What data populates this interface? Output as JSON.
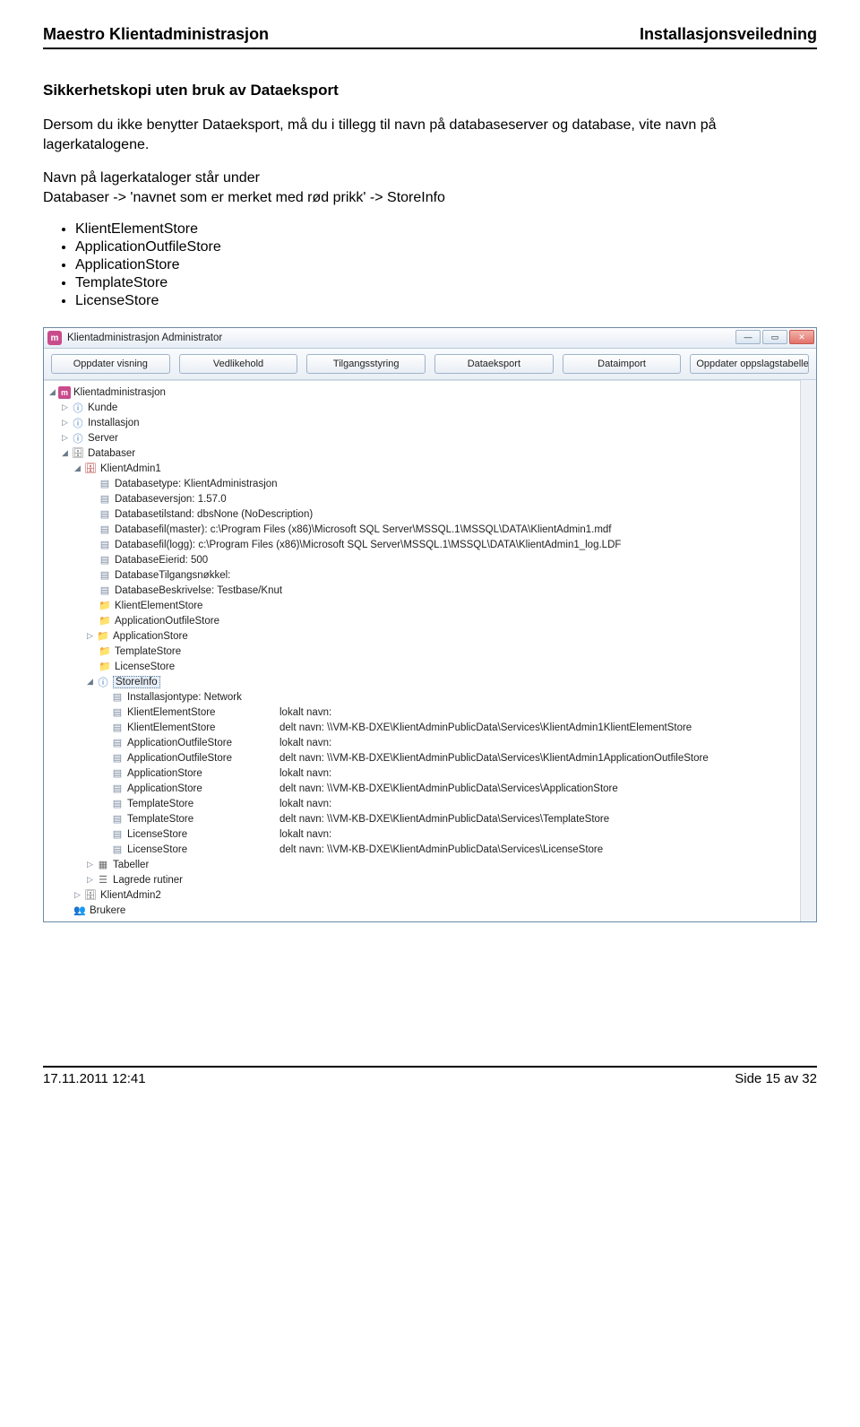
{
  "doc": {
    "header_left": "Maestro Klientadministrasjon",
    "header_right": "Installasjonsveiledning",
    "section_title": "Sikkerhetskopi uten bruk av Dataeksport",
    "para1": "Dersom du ikke benytter Dataeksport, må du i tillegg til navn på databaseserver og database, vite navn på lagerkatalogene.",
    "para2a": "Navn på lagerkataloger står under",
    "para2b": "Databaser -> 'navnet som er merket med rød prikk' -> StoreInfo",
    "stores": [
      "KlientElementStore",
      "ApplicationOutfileStore",
      "ApplicationStore",
      "TemplateStore",
      "LicenseStore"
    ],
    "footer_left": "17.11.2011 12:41",
    "footer_right": "Side 15 av 32"
  },
  "app": {
    "title": "Klientadministrasjon Administrator",
    "toolbar": [
      "Oppdater visning",
      "Vedlikehold",
      "Tilgangsstyring",
      "Dataeksport",
      "Dataimport",
      "Oppdater oppslagstabeller"
    ],
    "tree": {
      "root": "Klientadministrasjon",
      "top_children": [
        "Kunde",
        "Installasjon",
        "Server"
      ],
      "databaser": "Databaser",
      "db1": "KlientAdmin1",
      "db1_props": [
        "Databasetype: KlientAdministrasjon",
        "Databaseversjon: 1.57.0",
        "Databasetilstand: dbsNone (NoDescription)",
        "Databasefil(master): c:\\Program Files (x86)\\Microsoft SQL Server\\MSSQL.1\\MSSQL\\DATA\\KlientAdmin1.mdf",
        "Databasefil(logg): c:\\Program Files (x86)\\Microsoft SQL Server\\MSSQL.1\\MSSQL\\DATA\\KlientAdmin1_log.LDF",
        "DatabaseEierid: 500",
        "DatabaseTilgangsnøkkel:",
        "DatabaseBeskrivelse: Testbase/Knut"
      ],
      "db1_folders": [
        "KlientElementStore",
        "ApplicationOutfileStore",
        "ApplicationStore",
        "TemplateStore",
        "LicenseStore"
      ],
      "storeinfo": "StoreInfo",
      "storeinfo_first": "Installasjontype: Network",
      "storeinfo_rows": [
        {
          "k": "KlientElementStore",
          "v": "lokalt navn:"
        },
        {
          "k": "KlientElementStore",
          "v": "delt  navn: \\\\VM-KB-DXE\\KlientAdminPublicData\\Services\\KlientAdmin1KlientElementStore"
        },
        {
          "k": "ApplicationOutfileStore",
          "v": "lokalt navn:"
        },
        {
          "k": "ApplicationOutfileStore",
          "v": "delt  navn: \\\\VM-KB-DXE\\KlientAdminPublicData\\Services\\KlientAdmin1ApplicationOutfileStore"
        },
        {
          "k": "ApplicationStore",
          "v": "lokalt navn:"
        },
        {
          "k": "ApplicationStore",
          "v": "delt  navn: \\\\VM-KB-DXE\\KlientAdminPublicData\\Services\\ApplicationStore"
        },
        {
          "k": "TemplateStore",
          "v": "lokalt navn:"
        },
        {
          "k": "TemplateStore",
          "v": "delt  navn: \\\\VM-KB-DXE\\KlientAdminPublicData\\Services\\TemplateStore"
        },
        {
          "k": "LicenseStore",
          "v": "lokalt navn:"
        },
        {
          "k": "LicenseStore",
          "v": "delt  navn: \\\\VM-KB-DXE\\KlientAdminPublicData\\Services\\LicenseStore"
        }
      ],
      "db1_tail": [
        "Tabeller",
        "Lagrede rutiner"
      ],
      "db2": "KlientAdmin2",
      "brukere": "Brukere"
    }
  }
}
